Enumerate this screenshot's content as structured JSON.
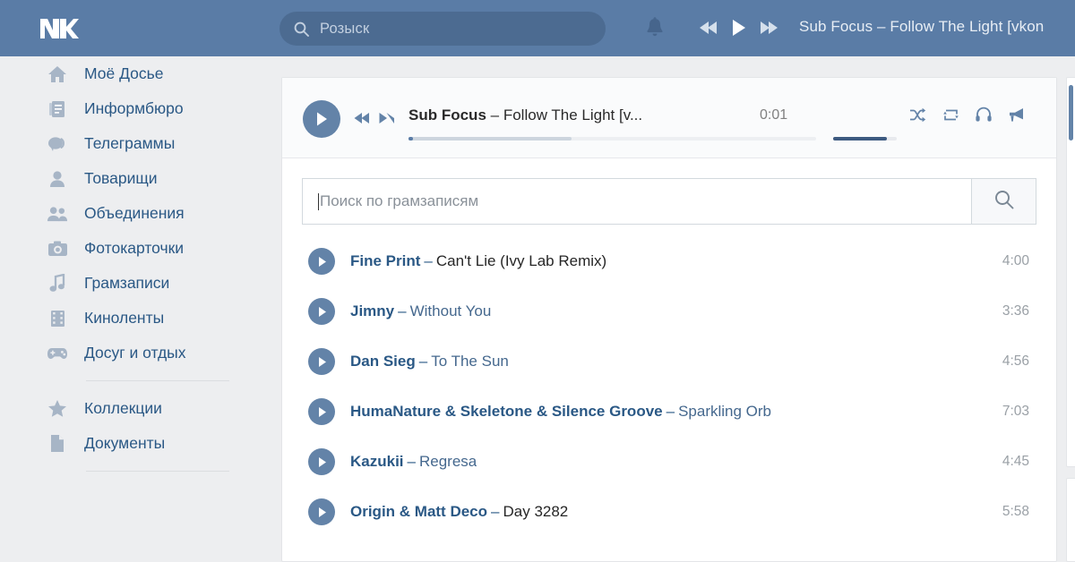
{
  "header": {
    "logo_icon": "vk-logo-icon",
    "search": {
      "icon": "search-icon",
      "placeholder": "Розыск",
      "value": ""
    },
    "bell_icon": "bell-icon",
    "mini_player": {
      "prev_icon": "prev-track-icon",
      "play_icon": "play-icon",
      "next_icon": "next-track-icon",
      "now_playing": "Sub Focus – Follow The Light [vkon"
    }
  },
  "sidebar": {
    "items": [
      {
        "label": "Моё Досье",
        "icon": "home-icon"
      },
      {
        "label": "Информбюро",
        "icon": "news-icon"
      },
      {
        "label": "Телеграммы",
        "icon": "messages-icon"
      },
      {
        "label": "Товарищи",
        "icon": "friends-icon"
      },
      {
        "label": "Объединения",
        "icon": "groups-icon"
      },
      {
        "label": "Фотокарточки",
        "icon": "photos-icon"
      },
      {
        "label": "Грамзаписи",
        "icon": "music-note-icon"
      },
      {
        "label": "Киноленты",
        "icon": "video-icon"
      },
      {
        "label": "Досуг и отдых",
        "icon": "gamepad-icon"
      }
    ],
    "items2": [
      {
        "label": "Коллекции",
        "icon": "star-icon"
      },
      {
        "label": "Документы",
        "icon": "document-icon"
      }
    ]
  },
  "player": {
    "play_icon": "play-icon",
    "prev_icon": "prev-track-icon",
    "next_icon": "next-track-icon",
    "artist": "Sub Focus",
    "separator": "–",
    "title": "Follow The Light [v...",
    "current_time": "0:01",
    "progress_percent": 1,
    "buffered_percent": 40,
    "volume_percent": 85,
    "controls": [
      {
        "icon": "shuffle-icon"
      },
      {
        "icon": "repeat-icon"
      },
      {
        "icon": "headphones-icon"
      },
      {
        "icon": "broadcast-icon"
      }
    ]
  },
  "search_panel": {
    "placeholder": "Поиск по грамзаписям",
    "value": "",
    "button_icon": "search-icon"
  },
  "tracks": [
    {
      "artist": "Fine Print",
      "sep": "–",
      "title": "Can't Lie (Ivy Lab Remix)",
      "duration": "4:00",
      "dark": true
    },
    {
      "artist": "Jimny",
      "sep": "–",
      "title": "Without You",
      "duration": "3:36",
      "dark": false
    },
    {
      "artist": "Dan Sieg",
      "sep": "–",
      "title": "To The Sun",
      "duration": "4:56",
      "dark": false
    },
    {
      "artist": "HumaNature & Skeletone & Silence Groove",
      "sep": "–",
      "title": "Sparkling Orb",
      "duration": "7:03",
      "dark": false
    },
    {
      "artist": "Kazukii",
      "sep": "–",
      "title": "Regresa",
      "duration": "4:45",
      "dark": false
    },
    {
      "artist": "Origin & Matt Deco",
      "sep": "–",
      "title": "Day 3282",
      "duration": "5:58",
      "dark": true
    }
  ],
  "colors": {
    "header_bg": "#5a7ca6",
    "page_bg": "#edeef0",
    "link": "#2a5885",
    "accent": "#6383a8",
    "muted": "#9aa0a6"
  }
}
